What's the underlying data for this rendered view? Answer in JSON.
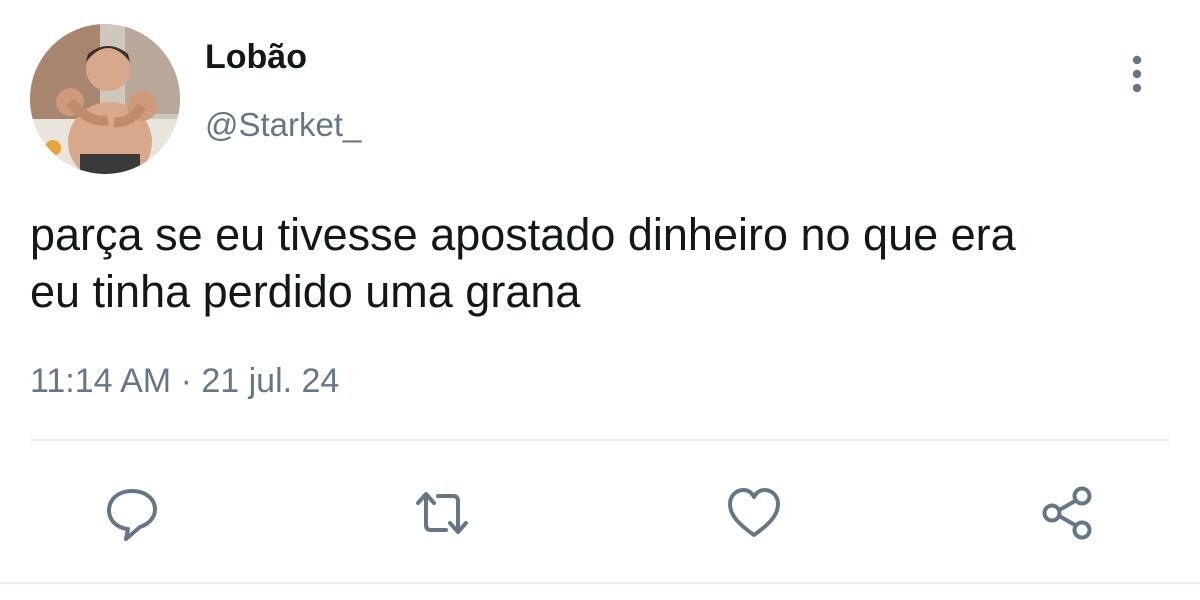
{
  "user": {
    "display_name": "Lobão",
    "handle": "@Starket_",
    "avatar_icon": "profile-photo"
  },
  "tweet": {
    "text_lines": [
      "parça se eu tivesse apostado dinheiro no que era",
      "eu tinha perdido uma grana"
    ],
    "timestamp": "11:14 AM · 21 jul. 24"
  },
  "actions": {
    "reply_icon": "speech-bubble",
    "retweet_icon": "retweet-arrows",
    "like_icon": "heart",
    "share_icon": "share-nodes",
    "more_icon": "vertical-ellipsis"
  },
  "colors": {
    "text": "#14171a",
    "secondary": "#657786",
    "icon": "#657786",
    "divider": "#e6ecf0"
  }
}
